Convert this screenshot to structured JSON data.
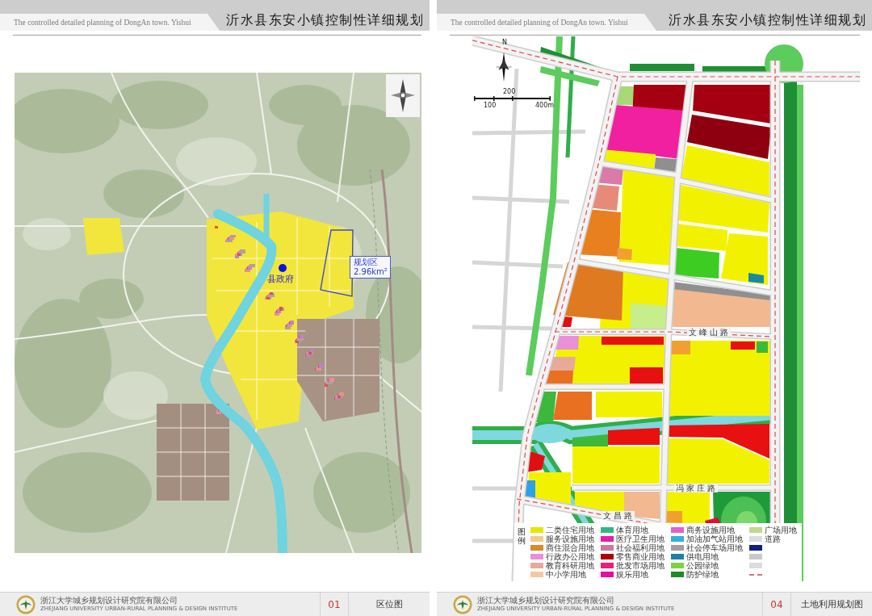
{
  "pages": [
    {
      "header": {
        "subtitle": "The controlled detailed planning of DongAn town. Yishui",
        "title": "沂水县东安小镇控制性详细规划"
      },
      "map": {
        "kind": "location",
        "seat": {
          "label": "县政府"
        },
        "zone": {
          "name": "规划区",
          "area": "2.96km²"
        }
      },
      "footer": {
        "institute": "浙江大学城乡规划设计研究院有限公司",
        "institute_en": "ZHEJIANG UNIVERSITY URBAN-RURAL PLANNING & DESIGN INSTITUTE",
        "page_number": "01",
        "sheet_title": "区位图"
      }
    },
    {
      "header": {
        "subtitle": "The controlled detailed planning of DongAn town. Yishui",
        "title": "沂水县东安小镇控制性详细规划"
      },
      "map": {
        "kind": "land_use",
        "north": "N",
        "scale": {
          "upper": "200",
          "lower": [
            "100",
            "400m"
          ]
        },
        "roads": [
          {
            "label": "文峰山路"
          },
          {
            "label": "冯家庄路"
          },
          {
            "label": "文昌路"
          }
        ],
        "legend": {
          "title": "图例",
          "items": [
            {
              "kind": "swatch",
              "label": "二类住宅用地",
              "color": "#e6e600"
            },
            {
              "kind": "swatch",
              "label": "服务设施用地",
              "color": "#f5c88c"
            },
            {
              "kind": "swatch",
              "label": "商住混合用地",
              "color": "#d98a2a"
            },
            {
              "kind": "swatch",
              "label": "行政办公用地",
              "color": "#e890d8"
            },
            {
              "kind": "swatch",
              "label": "教育科研用地",
              "color": "#e8a99a"
            },
            {
              "kind": "swatch",
              "label": "中小学用地",
              "color": "#f5c8a0"
            },
            {
              "kind": "swatch",
              "label": "体育用地",
              "color": "#33b58a"
            },
            {
              "kind": "swatch",
              "label": "医疗卫生用地",
              "color": "#e020b0"
            },
            {
              "kind": "swatch",
              "label": "社会福利用地",
              "color": "#c87a9a"
            },
            {
              "kind": "swatch",
              "label": "零售商业用地",
              "color": "#b00000"
            },
            {
              "kind": "swatch",
              "label": "批发市场用地",
              "color": "#e8207a"
            },
            {
              "kind": "swatch",
              "label": "娱乐用地",
              "color": "#e010a0"
            },
            {
              "kind": "swatch",
              "label": "商务设施用地",
              "color": "#e060d0"
            },
            {
              "kind": "swatch",
              "label": "加油加气站用地",
              "color": "#30b0e0"
            },
            {
              "kind": "swatch",
              "label": "社会停车场用地",
              "color": "#a0a0a0"
            },
            {
              "kind": "swatch",
              "label": "供电用地",
              "color": "#2080a0"
            },
            {
              "kind": "swatch",
              "label": "公园绿地",
              "color": "#80d040"
            },
            {
              "kind": "swatch",
              "label": "防护绿地",
              "color": "#1e8a2a"
            },
            {
              "kind": "swatch",
              "label": "广场用地",
              "color": "#c0d890"
            },
            {
              "kind": "swatch",
              "label": "道路",
              "color": "#d8dde0"
            },
            {
              "kind": "swatch",
              "color": "#102080"
            },
            {
              "kind": "swatch",
              "color": "#c8c8c8"
            },
            {
              "kind": "swatch",
              "color": "#dcdcdc"
            },
            {
              "kind": "line",
              "color": "#e07080"
            }
          ]
        }
      },
      "footer": {
        "institute": "浙江大学城乡规划设计研究院有限公司",
        "institute_en": "ZHEJIANG UNIVERSITY URBAN-RURAL PLANNING & DESIGN INSTITUTE",
        "page_number": "04",
        "sheet_title": "土地利用规划图"
      }
    }
  ]
}
